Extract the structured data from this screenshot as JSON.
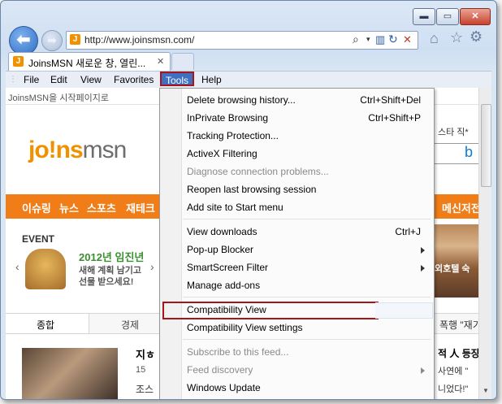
{
  "window": {
    "minimize_glyph": "▬",
    "restore_glyph": "▭",
    "close_glyph": "✕"
  },
  "address_bar": {
    "url": "http://www.joinsmsn.com/"
  },
  "tab": {
    "title": "JoinsMSN 새로운 창, 열린...",
    "close_glyph": "✕"
  },
  "favicon_letter": "J",
  "menu_bar": [
    "File",
    "Edit",
    "View",
    "Favorites",
    "Tools",
    "Help"
  ],
  "page": {
    "top_link": "JoinsMSN을 시작페이지로",
    "logo_text_1": "jo!ns",
    "logo_text_2": "msn",
    "right_snippet": "스타 직*",
    "nav": [
      "이슈링",
      "뉴스",
      "스포츠",
      "재테크"
    ],
    "nav_right": "메신저전",
    "event_label": "EVENT",
    "event_title": "2012년 임진년",
    "event_line1": "새해 계획 남기고",
    "event_line2": "선물 받으세요!",
    "hotel_snippet": "외호텔 숙",
    "tabs": [
      "종합",
      "경제"
    ],
    "right_tab_snippet": "폭행 \"재기",
    "news_heading": "지ㅎ",
    "news_sub1": "15",
    "news_sub2": "조스",
    "right_news1": "적 人 등장",
    "right_news2": "사연에 \"",
    "right_news3": "니었다!\""
  },
  "tools_menu": {
    "items": [
      {
        "label": "Delete browsing history...",
        "shortcut": "Ctrl+Shift+Del",
        "disabled": false
      },
      {
        "label": "InPrivate Browsing",
        "shortcut": "Ctrl+Shift+P",
        "disabled": false
      },
      {
        "label": "Tracking Protection...",
        "shortcut": "",
        "disabled": false
      },
      {
        "label": "ActiveX Filtering",
        "shortcut": "",
        "disabled": false
      },
      {
        "label": "Diagnose connection problems...",
        "shortcut": "",
        "disabled": true
      },
      {
        "label": "Reopen last browsing session",
        "shortcut": "",
        "disabled": false
      },
      {
        "label": "Add site to Start menu",
        "shortcut": "",
        "disabled": false
      },
      {
        "label": "View downloads",
        "shortcut": "Ctrl+J",
        "disabled": false
      },
      {
        "label": "Pop-up Blocker",
        "shortcut": "",
        "disabled": false
      },
      {
        "label": "SmartScreen Filter",
        "shortcut": "",
        "disabled": false
      },
      {
        "label": "Manage add-ons",
        "shortcut": "",
        "disabled": false
      },
      {
        "label": "Compatibility View",
        "shortcut": "",
        "disabled": false
      },
      {
        "label": "Compatibility View settings",
        "shortcut": "",
        "disabled": false
      },
      {
        "label": "Subscribe to this feed...",
        "shortcut": "",
        "disabled": true
      },
      {
        "label": "Feed discovery",
        "shortcut": "",
        "disabled": true
      },
      {
        "label": "Windows Update",
        "shortcut": "",
        "disabled": false
      }
    ]
  },
  "colors": {
    "highlight_box": "#a6141c",
    "nav_orange": "#f07d18",
    "logo_orange": "#f29100"
  }
}
